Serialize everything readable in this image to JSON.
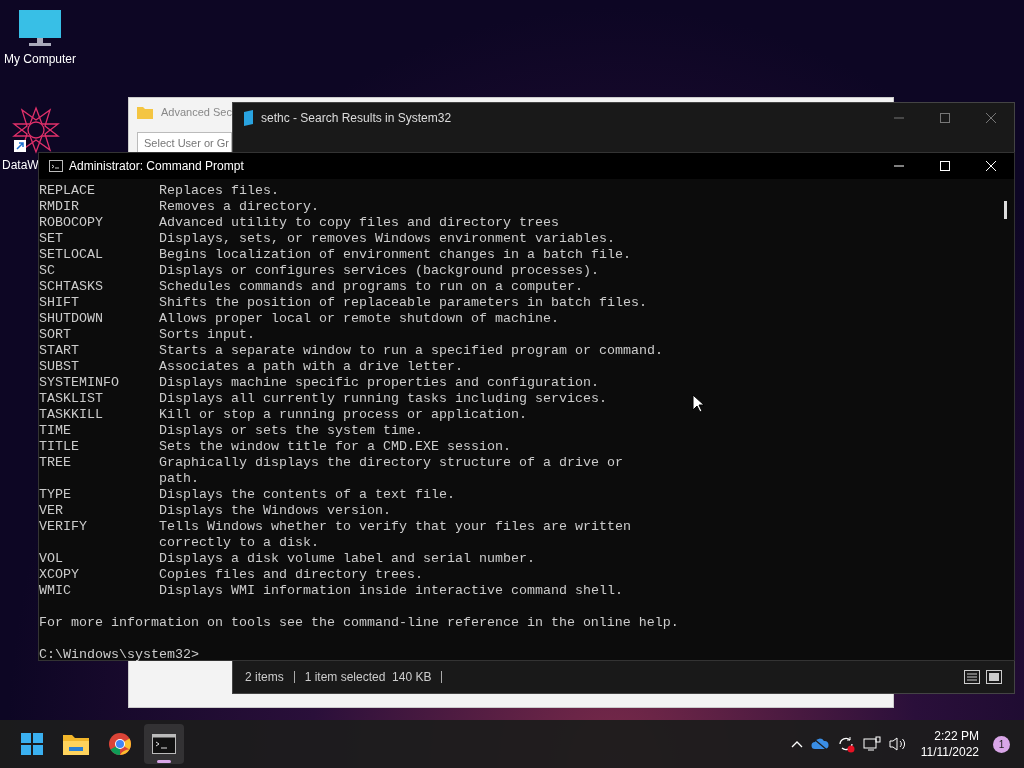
{
  "desktop_icons": [
    {
      "label": "My Computer",
      "kind": "monitor"
    },
    {
      "label": "DataW",
      "kind": "star"
    }
  ],
  "advanced_window": {
    "title": "Advanced Sec",
    "button": "Select User or Gr"
  },
  "explorer_window": {
    "title": "sethc - Search Results in System32",
    "status_bar": [
      "2 items",
      "1 item selected  140 KB"
    ]
  },
  "cmd_window": {
    "title": "Administrator: Command Prompt",
    "lines": [
      {
        "name": "REPLACE",
        "description": [
          "Replaces files."
        ]
      },
      {
        "name": "RMDIR",
        "description": [
          "Removes a directory."
        ]
      },
      {
        "name": "ROBOCOPY",
        "description": [
          "Advanced utility to copy files and directory trees"
        ]
      },
      {
        "name": "SET",
        "description": [
          "Displays, sets, or removes Windows environment variables."
        ]
      },
      {
        "name": "SETLOCAL",
        "description": [
          "Begins localization of environment changes in a batch file."
        ]
      },
      {
        "name": "SC",
        "description": [
          "Displays or configures services (background processes)."
        ]
      },
      {
        "name": "SCHTASKS",
        "description": [
          "Schedules commands and programs to run on a computer."
        ]
      },
      {
        "name": "SHIFT",
        "description": [
          "Shifts the position of replaceable parameters in batch files."
        ]
      },
      {
        "name": "SHUTDOWN",
        "description": [
          "Allows proper local or remote shutdown of machine."
        ]
      },
      {
        "name": "SORT",
        "description": [
          "Sorts input."
        ]
      },
      {
        "name": "START",
        "description": [
          "Starts a separate window to run a specified program or command."
        ]
      },
      {
        "name": "SUBST",
        "description": [
          "Associates a path with a drive letter."
        ]
      },
      {
        "name": "SYSTEMINFO",
        "description": [
          "Displays machine specific properties and configuration."
        ]
      },
      {
        "name": "TASKLIST",
        "description": [
          "Displays all currently running tasks including services."
        ]
      },
      {
        "name": "TASKKILL",
        "description": [
          "Kill or stop a running process or application."
        ]
      },
      {
        "name": "TIME",
        "description": [
          "Displays or sets the system time."
        ]
      },
      {
        "name": "TITLE",
        "description": [
          "Sets the window title for a CMD.EXE session."
        ]
      },
      {
        "name": "TREE",
        "description": [
          "Graphically displays the directory structure of a drive or",
          "path."
        ]
      },
      {
        "name": "TYPE",
        "description": [
          "Displays the contents of a text file."
        ]
      },
      {
        "name": "VER",
        "description": [
          "Displays the Windows version."
        ]
      },
      {
        "name": "VERIFY",
        "description": [
          "Tells Windows whether to verify that your files are written",
          "correctly to a disk."
        ]
      },
      {
        "name": "VOL",
        "description": [
          "Displays a disk volume label and serial number."
        ]
      },
      {
        "name": "XCOPY",
        "description": [
          "Copies files and directory trees."
        ]
      },
      {
        "name": "WMIC",
        "description": [
          "Displays WMI information inside interactive command shell."
        ]
      }
    ],
    "footer": "For more information on tools see the command-line reference in the online help.",
    "prompt": "C:\\Windows\\system32>"
  },
  "taskbar": {
    "apps": [
      {
        "kind": "start",
        "selected": false
      },
      {
        "kind": "folder",
        "selected": false
      },
      {
        "kind": "browser",
        "selected": false
      },
      {
        "kind": "terminal",
        "selected": true
      }
    ],
    "time": "2:22 PM",
    "date": "11/11/2022",
    "notifications": "1"
  }
}
